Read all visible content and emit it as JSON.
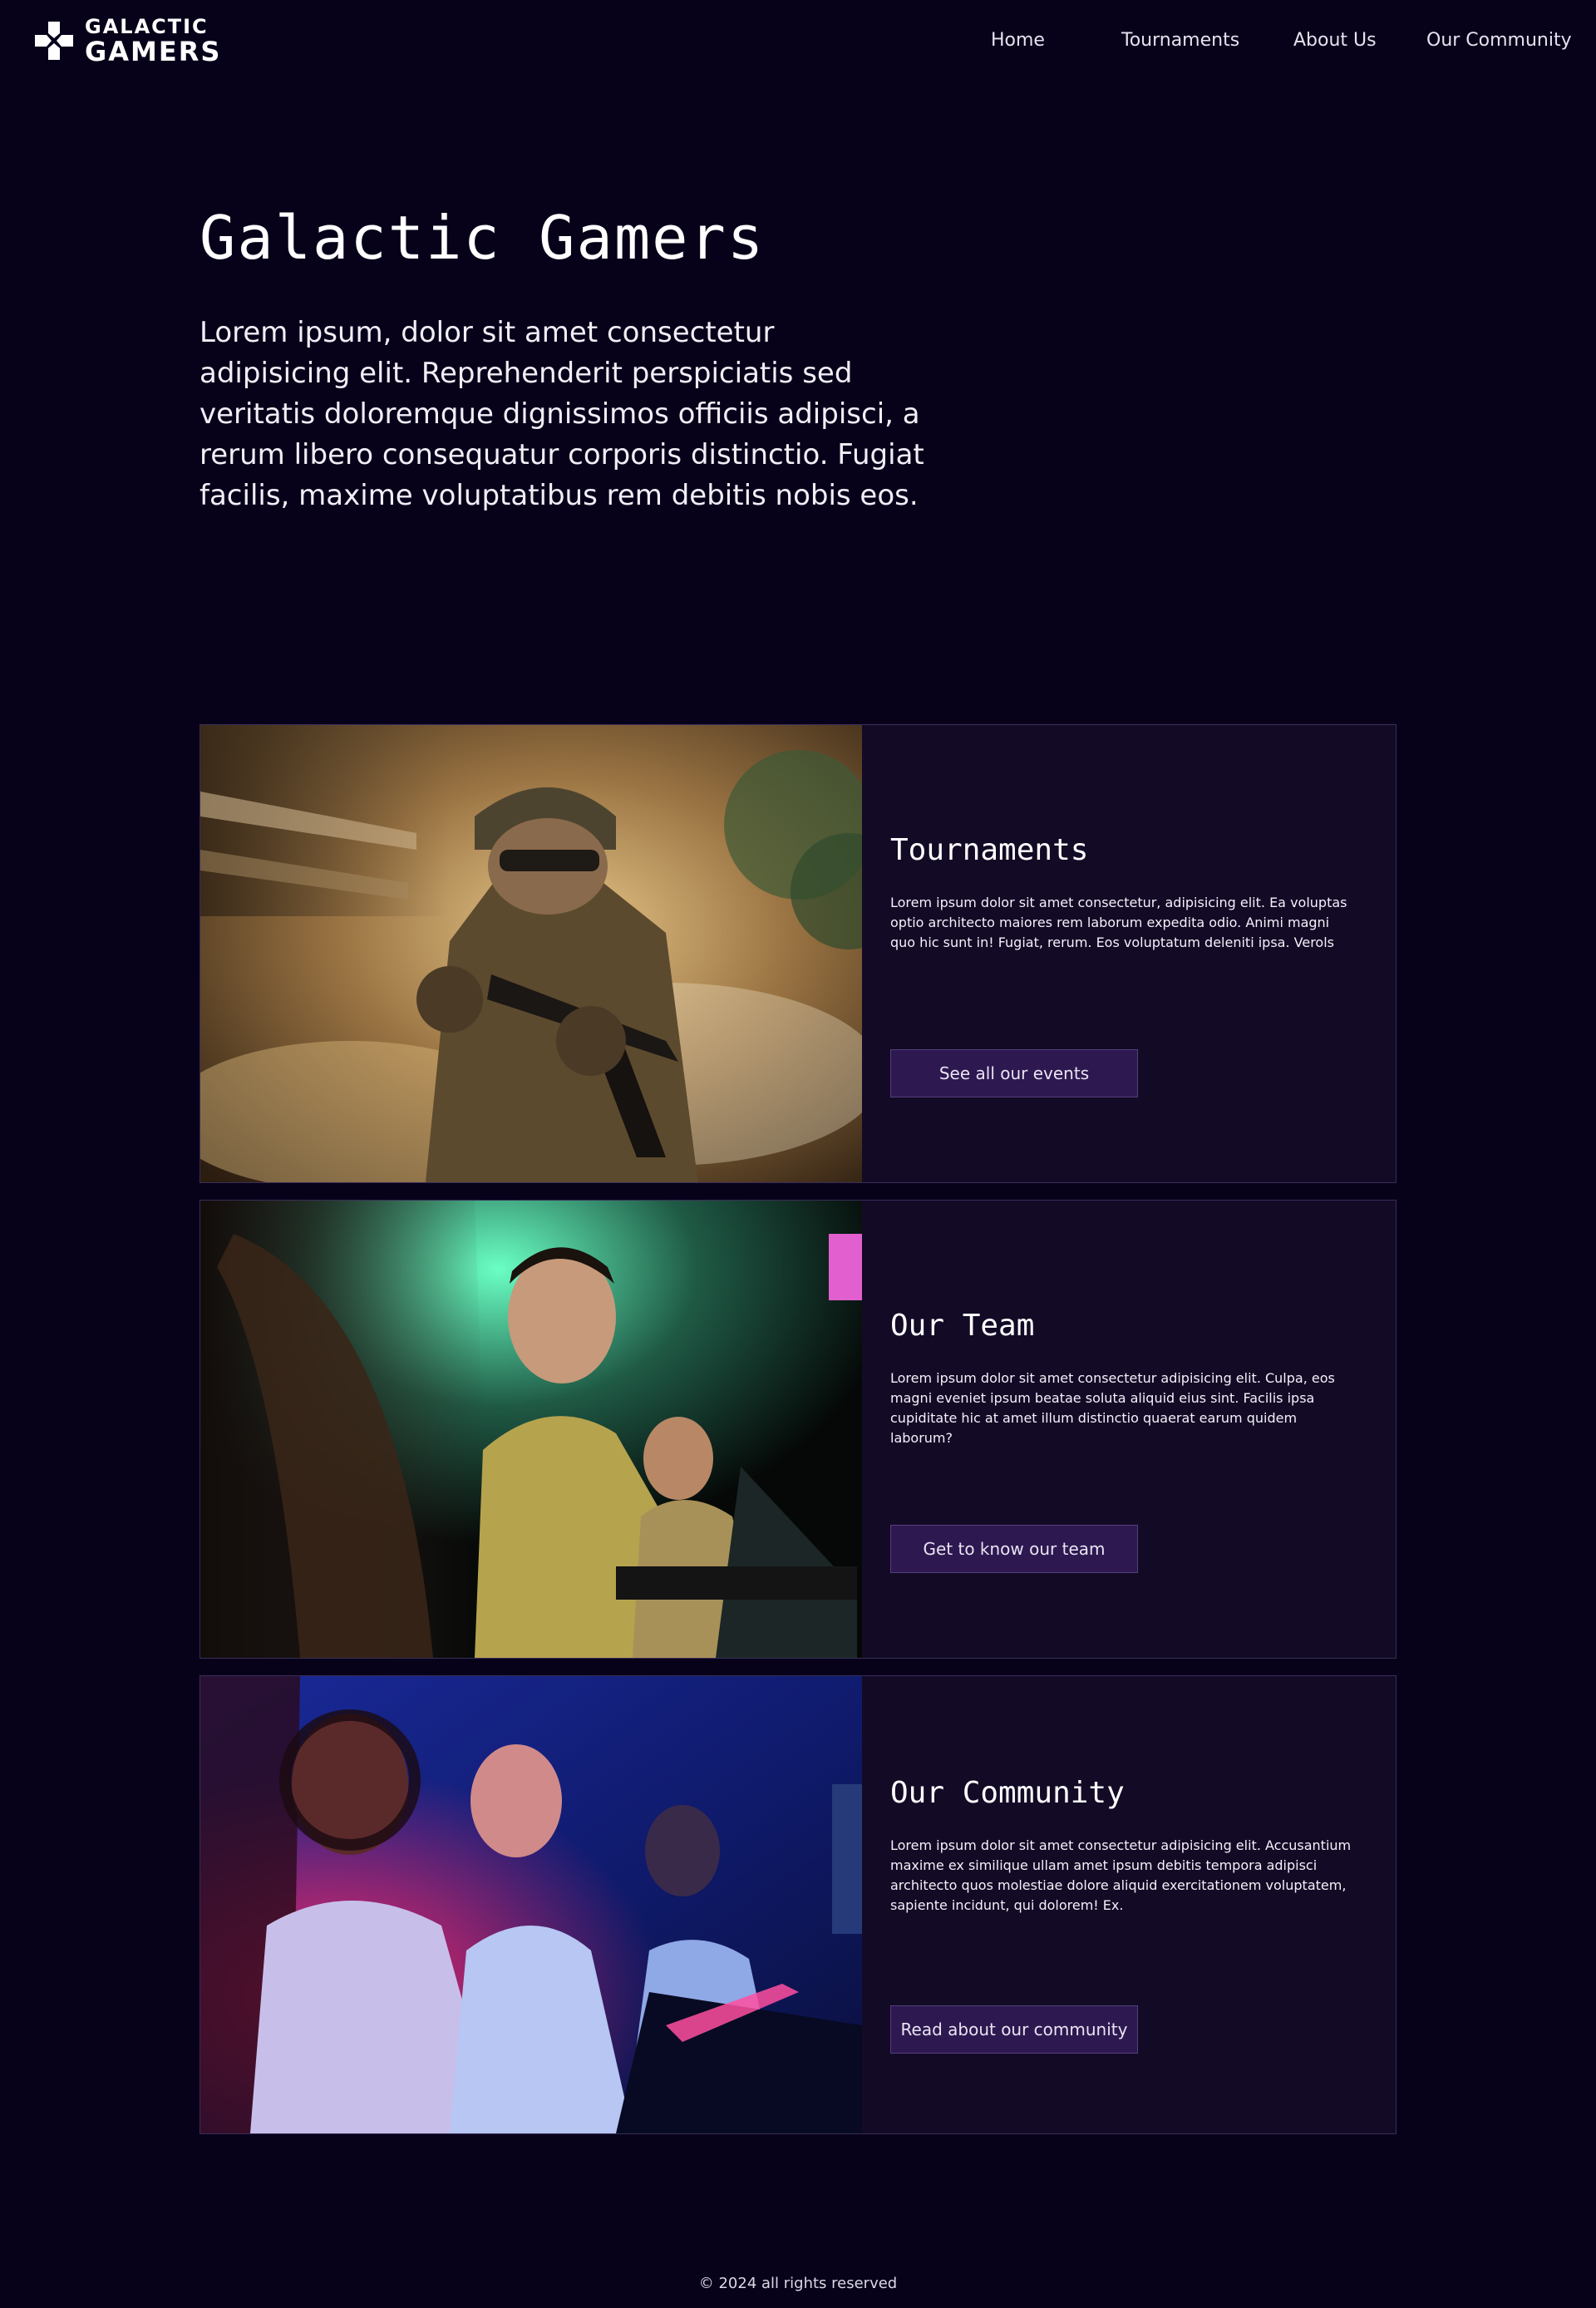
{
  "brand": {
    "line1": "GALACTIC",
    "line2": "GAMERS"
  },
  "nav": [
    {
      "label": "Home"
    },
    {
      "label": "Tournaments"
    },
    {
      "label": "About Us"
    },
    {
      "label": "Our Community"
    }
  ],
  "hero": {
    "title": "Galactic Gamers",
    "text": "Lorem ipsum, dolor sit amet consectetur adipisicing elit. Reprehenderit perspiciatis sed veritatis doloremque dignissimos officiis adipisci, a rerum libero consequatur corporis distinctio. Fugiat facilis, maxime voluptatibus rem debitis nobis eos."
  },
  "cards": [
    {
      "title": "Tournaments",
      "text": "Lorem ipsum dolor sit amet consectetur, adipisicing elit. Ea voluptas optio architecto maiores rem laborum expedita odio. Animi magni quo hic sunt in! Fugiat, rerum. Eos voluptatum deleniti ipsa. Verols",
      "button": "See all our events"
    },
    {
      "title": "Our Team",
      "text": "Lorem ipsum dolor sit amet consectetur adipisicing elit. Culpa, eos magni eveniet ipsum beatae soluta aliquid eius sint. Facilis ipsa cupiditate hic at amet illum distinctio quaerat earum quidem laborum?",
      "button": "Get to know our team"
    },
    {
      "title": "Our Community",
      "text": "Lorem ipsum dolor sit amet consectetur adipisicing elit. Accusantium maxime ex similique ullam amet ipsum debitis tempora adipisci architecto quos molestiae dolore aliquid exercitationem voluptatem, sapiente incidunt, qui dolorem! Ex.",
      "button": "Read about our community"
    }
  ],
  "footer": {
    "text": "© 2024 all rights reserved"
  },
  "colors": {
    "background": "#07021a",
    "card": "#130a26",
    "button": "#2d1850",
    "border": "#3a2c58"
  }
}
